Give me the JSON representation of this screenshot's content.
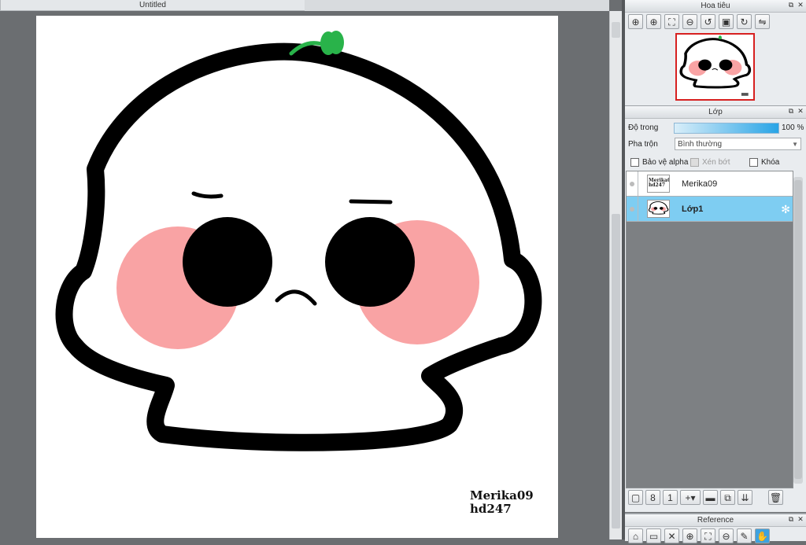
{
  "document": {
    "tab_title": "Untitled"
  },
  "canvas": {
    "signature_line1": "Merika09",
    "signature_line2": "hd247",
    "colors": {
      "outline": "#000000",
      "blush": "#f9a3a4",
      "sprout": "#29b34a"
    }
  },
  "navigator": {
    "title": "Hoa tiêu",
    "tools": [
      "zoom-in-icon",
      "zoom-in-icon",
      "fit-icon",
      "zoom-out-icon",
      "rotate-left-icon",
      "fit-window-icon",
      "rotate-right-icon",
      "flip-icon"
    ]
  },
  "layers": {
    "title": "Lớp",
    "opacity_label": "Độ trong",
    "opacity_value": "100 %",
    "opacity_fraction": 1.0,
    "blend_label": "Pha trộn",
    "blend_value": "Bình thường",
    "protect_alpha_label": "Bảo vệ alpha",
    "clipping_label": "Xén bớt",
    "lock_label": "Khóa",
    "items": [
      {
        "name": "Merika09",
        "thumb_text_1": "Merika09",
        "thumb_text_2": "hd247",
        "selected": false
      },
      {
        "name": "Lớp1",
        "selected": true
      }
    ],
    "accent_color": "#7ecdf2"
  },
  "reference": {
    "title": "Reference"
  }
}
